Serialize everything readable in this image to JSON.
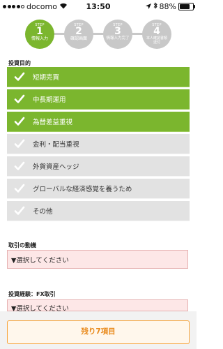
{
  "status_bar": {
    "carrier": "docomo",
    "time": "13:50",
    "battery": "88%",
    "battery_level": 0.88
  },
  "steps": [
    {
      "step_label": "STEP",
      "number": "1",
      "name": "情報入力",
      "active": true
    },
    {
      "step_label": "STEP",
      "number": "2",
      "name": "確認画面",
      "active": false
    },
    {
      "step_label": "STEP",
      "number": "3",
      "name": "情報入力完了",
      "active": false
    },
    {
      "step_label": "STEP",
      "number": "4",
      "name": "本人確認書類送付",
      "active": false
    }
  ],
  "investment_purpose": {
    "label": "投資目的",
    "options": [
      {
        "label": "短期売買",
        "checked": true
      },
      {
        "label": "中長期運用",
        "checked": true
      },
      {
        "label": "為替差益重視",
        "checked": true
      },
      {
        "label": "金利・配当重視",
        "checked": false
      },
      {
        "label": "外貨資産ヘッジ",
        "checked": false
      },
      {
        "label": "グローバルな経済感覚を養うため",
        "checked": false
      },
      {
        "label": "その他",
        "checked": false
      }
    ]
  },
  "trade_motive": {
    "label": "取引の動機",
    "value": "▼選択してください"
  },
  "fx_experience": {
    "label": "投資経験：FX取引",
    "value": "▼選択してください"
  },
  "bottom_button": {
    "label": "残り7項目"
  },
  "colors": {
    "accent": "#7bb62e",
    "inactive": "#c8c8c8",
    "select_bg": "#fde7e7",
    "button_border": "#f5a33a"
  }
}
